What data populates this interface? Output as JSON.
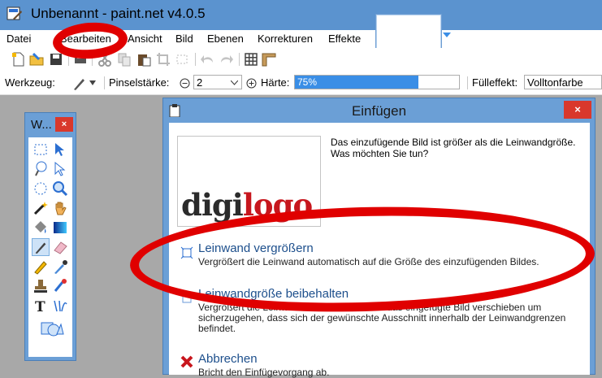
{
  "window": {
    "title": "Unbenannt - paint.net v4.0.5"
  },
  "menu": [
    "Datei",
    "Bearbeiten",
    "Ansicht",
    "Bild",
    "Ebenen",
    "Korrekturen",
    "Effekte"
  ],
  "toolbar2": {
    "tool_label": "Werkzeug:",
    "brush_label": "Pinselstärke:",
    "brush_value": "2",
    "hardness_label": "Härte:",
    "hardness_value": "75%",
    "hardness_fraction": 0.75,
    "fill_label": "Fülleffekt:",
    "fill_value": "Volltonfarbe"
  },
  "tools_window": {
    "title": "W...",
    "close": "×"
  },
  "dialog": {
    "title": "Einfügen",
    "close": "×",
    "logo_part1": "digi",
    "logo_part2": "logo",
    "question_line1": "Das einzufügende Bild ist größer als die Leinwandgröße.",
    "question_line2": "Was möchten Sie tun?",
    "options": [
      {
        "title": "Leinwand vergrößern",
        "desc": "Vergrößert die Leinwand automatisch auf die Größe des einzufügenden Bildes."
      },
      {
        "title": "Leinwandgröße beibehalten",
        "desc": "Vergrößert die Leinwand nicht. Sie müssen das eingefügte Bild verschieben um sicherzugehen, dass sich der gewünschte Ausschnitt innerhalb der Leinwandgrenzen befindet."
      },
      {
        "title": "Abbrechen",
        "desc": "Bricht den Einfügevorgang ab."
      }
    ]
  },
  "colors": {
    "titlebar": "#5b93cf",
    "accent": "#3a8ee6",
    "close": "#d9382c",
    "annotation": "#e00000"
  }
}
